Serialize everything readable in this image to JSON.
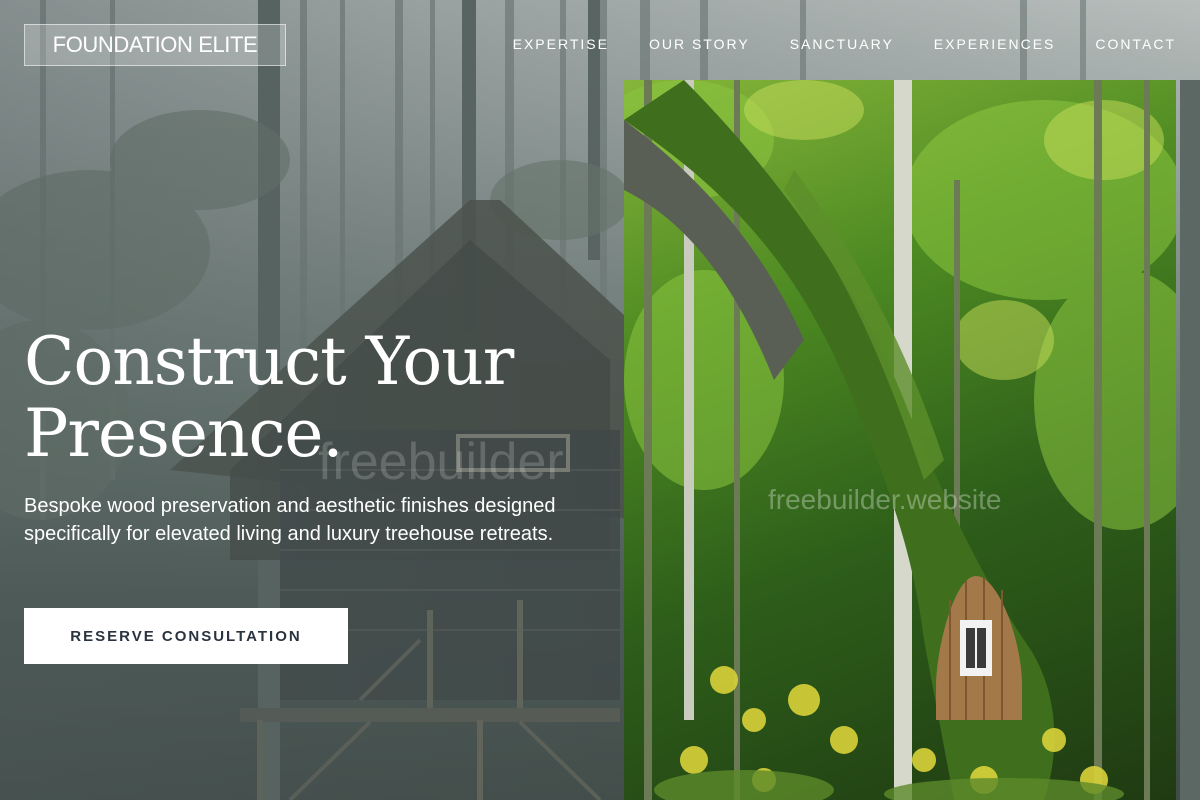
{
  "brand": {
    "name": "FOUNDATION ELITE"
  },
  "nav": {
    "items": [
      {
        "label": "EXPERTISE"
      },
      {
        "label": "OUR STORY"
      },
      {
        "label": "SANCTUARY"
      },
      {
        "label": "EXPERIENCES"
      },
      {
        "label": "CONTACT"
      }
    ]
  },
  "hero": {
    "headline_line1": "Construct Your",
    "headline_line2": "Presence.",
    "subtext": "Bespoke wood preservation and aesthetic finishes designed specifically for elevated living and luxury treehouse retreats.",
    "cta_label": "RESERVE CONSULTATION"
  },
  "watermark": {
    "left_text": "freebuilder",
    "right_text": "freebuilder.website"
  },
  "colors": {
    "cta_bg": "#ffffff",
    "cta_text": "#2a3340",
    "overlay": "#4e5a5a"
  },
  "images": {
    "background": "misty-forest-treehouse-photo",
    "feature": "mossy-tree-fairy-door-photo"
  }
}
